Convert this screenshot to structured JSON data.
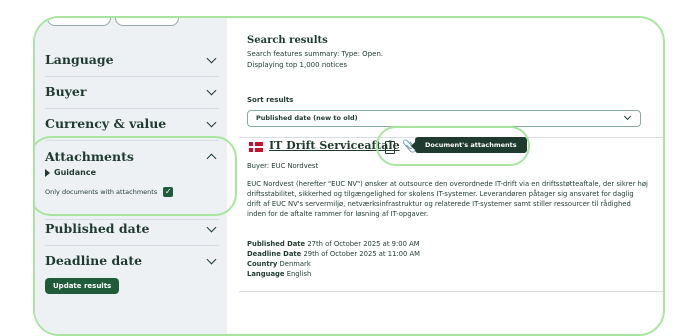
{
  "sidebar": {
    "facets": [
      {
        "label": "Language"
      },
      {
        "label": "Buyer"
      },
      {
        "label": "Currency & value"
      },
      {
        "label": "Attachments"
      },
      {
        "label": "Published date"
      },
      {
        "label": "Deadline date"
      }
    ],
    "guidance_label": "Guidance",
    "only_docs_label": "Only documents with attachments",
    "only_docs_checked": "✓",
    "update_button": "Update results"
  },
  "results": {
    "title": "Search results",
    "summary": "Search features summary: Type: Open.",
    "displaying": "Displaying top 1,000 notices",
    "sort_label": "Sort results",
    "sort_value": "Published date (new to old)"
  },
  "notice": {
    "title": "IT Drift Serviceaftale",
    "attachments_tooltip": "Document's attachments",
    "buyer": "Buyer: EUC Nordvest",
    "description": "EUC Nordvest (herefter \"EUC NV\") ønsker at outsource den overordnede IT-drift via en driftsstøtteaftale, der sikrer høj driftsstabilitet, sikkerhed og tilgængelighed for skolens IT-systemer. Leverandøren påtager sig ansvaret for daglig drift af EUC NV's servermiljø, netværksinfrastruktur og relaterede IT-systemer samt stiller ressourcer til rådighed inden for de aftalte rammer for løsning af IT-opgaver.",
    "published_label": "Published Date",
    "published_value": "27th of October 2025 at 9:00 AM",
    "deadline_label": "Deadline Date",
    "deadline_value": "29th of October 2025 at 11:00 AM",
    "country_label": "Country",
    "country_value": "Denmark",
    "language_label": "Language",
    "language_value": "English"
  }
}
